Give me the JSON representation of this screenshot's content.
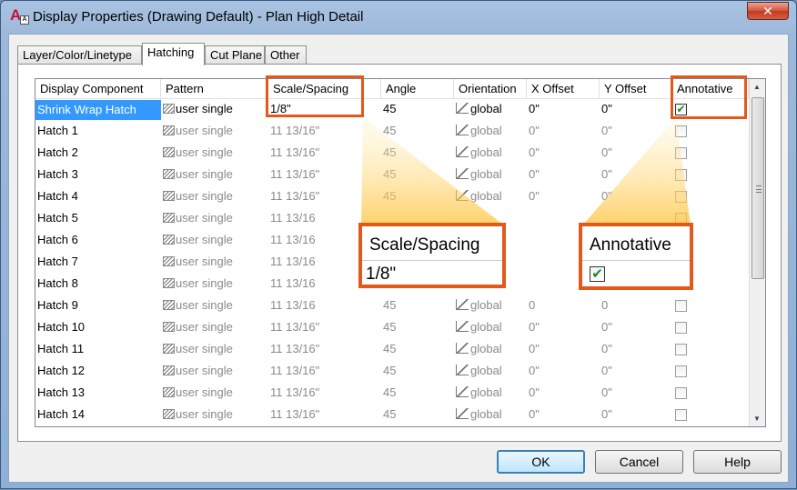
{
  "window": {
    "title": "Display Properties (Drawing Default) - Plan High Detail",
    "close_glyph": "✕"
  },
  "tabs": [
    {
      "label": "Layer/Color/Linetype",
      "active": false
    },
    {
      "label": "Hatching",
      "active": true
    },
    {
      "label": "Cut Plane",
      "active": false
    },
    {
      "label": "Other",
      "active": false
    }
  ],
  "grid": {
    "columns": [
      "Display Component",
      "Pattern",
      "Scale/Spacing",
      "Angle",
      "Orientation",
      "X Offset",
      "Y Offset",
      "Annotative"
    ],
    "rows": [
      {
        "name": "Shrink Wrap Hatch",
        "pattern": "user single",
        "scale": "1/8\"",
        "angle": "45",
        "orientation": "global",
        "x": "0\"",
        "y": "0\"",
        "annotative": true,
        "selected": true
      },
      {
        "name": "Hatch 1",
        "pattern": "user single",
        "scale": "11 13/16\"",
        "angle": "45",
        "orientation": "global",
        "x": "0\"",
        "y": "0\"",
        "annotative": false
      },
      {
        "name": "Hatch 2",
        "pattern": "user single",
        "scale": "11 13/16\"",
        "angle": "45",
        "orientation": "global",
        "x": "0\"",
        "y": "0\"",
        "annotative": false
      },
      {
        "name": "Hatch 3",
        "pattern": "user single",
        "scale": "11 13/16\"",
        "angle": "45",
        "orientation": "global",
        "x": "0\"",
        "y": "0\"",
        "annotative": false
      },
      {
        "name": "Hatch 4",
        "pattern": "user single",
        "scale": "11 13/16\"",
        "angle": "45",
        "orientation": "global",
        "x": "0\"",
        "y": "0\"",
        "annotative": false
      },
      {
        "name": "Hatch 5",
        "pattern": "user single",
        "scale": "11 13/16",
        "angle": "",
        "orientation": "",
        "x": "",
        "y": "",
        "annotative": false
      },
      {
        "name": "Hatch 6",
        "pattern": "user single",
        "scale": "11 13/16",
        "angle": "",
        "orientation": "",
        "x": "",
        "y": "",
        "annotative": false
      },
      {
        "name": "Hatch 7",
        "pattern": "user single",
        "scale": "11 13/16",
        "angle": "",
        "orientation": "",
        "x": "",
        "y": "",
        "annotative": false
      },
      {
        "name": "Hatch 8",
        "pattern": "user single",
        "scale": "11 13/16",
        "angle": "",
        "orientation": "",
        "x": "",
        "y": "",
        "annotative": false
      },
      {
        "name": "Hatch 9",
        "pattern": "user single",
        "scale": "11 13/16",
        "angle": "45",
        "orientation": "global",
        "x": "0",
        "y": "0",
        "annotative": false
      },
      {
        "name": "Hatch 10",
        "pattern": "user single",
        "scale": "11 13/16\"",
        "angle": "45",
        "orientation": "global",
        "x": "0\"",
        "y": "0\"",
        "annotative": false
      },
      {
        "name": "Hatch 11",
        "pattern": "user single",
        "scale": "11 13/16\"",
        "angle": "45",
        "orientation": "global",
        "x": "0\"",
        "y": "0\"",
        "annotative": false
      },
      {
        "name": "Hatch 12",
        "pattern": "user single",
        "scale": "11 13/16\"",
        "angle": "45",
        "orientation": "global",
        "x": "0\"",
        "y": "0\"",
        "annotative": false
      },
      {
        "name": "Hatch 13",
        "pattern": "user single",
        "scale": "11 13/16\"",
        "angle": "45",
        "orientation": "global",
        "x": "0\"",
        "y": "0\"",
        "annotative": false
      },
      {
        "name": "Hatch 14",
        "pattern": "user single",
        "scale": "11 13/16\"",
        "angle": "45",
        "orientation": "global",
        "x": "0\"",
        "y": "0\"",
        "annotative": false
      }
    ]
  },
  "callouts": {
    "scale": {
      "title": "Scale/Spacing",
      "value": "1/8\""
    },
    "annotative": {
      "title": "Annotative",
      "checked": true
    }
  },
  "buttons": {
    "ok": "OK",
    "cancel": "Cancel",
    "help": "Help"
  },
  "icons": {
    "pattern": "hatch-swatch-icon",
    "orientation": "orientation-icon",
    "check": "✔",
    "scroll_up": "▲",
    "scroll_down": "▼"
  },
  "colors": {
    "accent": "#e2591c",
    "selection": "#3399ff",
    "check": "#1f8a1f"
  }
}
